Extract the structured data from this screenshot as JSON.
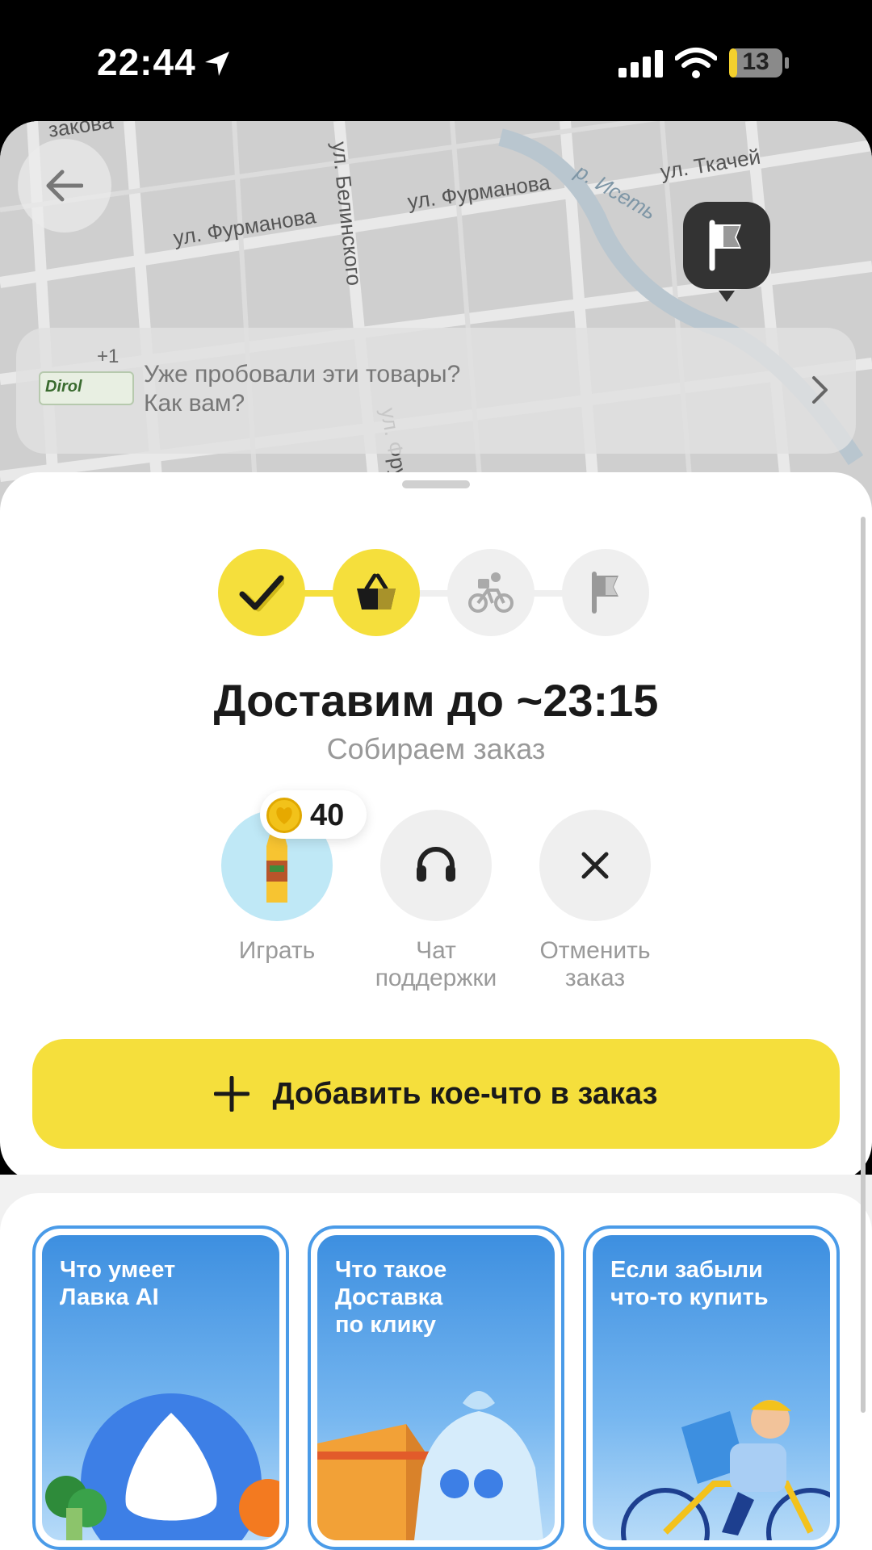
{
  "status_bar": {
    "time": "22:44",
    "battery": "13"
  },
  "map": {
    "streets": [
      "ул. Фурманова",
      "ул. Фурманова",
      "ул. Белинского",
      "ул. Ткачей",
      "р. Исеть",
      "ул. Фрунзе",
      "ул. Фрунзе",
      "ул. Бели",
      "закова"
    ]
  },
  "review_prompt": {
    "plus_count": "+1",
    "thumb_text": "Dirol",
    "line1": "Уже пробовали эти товары?",
    "line2": "Как вам?"
  },
  "order": {
    "eta_title": "Доставим до ~23:15",
    "status": "Собираем заказ",
    "steps": [
      {
        "name": "confirmed",
        "icon": "check-icon",
        "state": "done"
      },
      {
        "name": "assembling",
        "icon": "basket-icon",
        "state": "done"
      },
      {
        "name": "courier",
        "icon": "cyclist-icon",
        "state": "pending"
      },
      {
        "name": "delivered",
        "icon": "flag-icon",
        "state": "pending"
      }
    ]
  },
  "actions": {
    "play_label": "Играть",
    "coins": "40",
    "support_line1": "Чат",
    "support_line2": "поддержки",
    "cancel_line1": "Отменить",
    "cancel_line2": "заказ"
  },
  "add_button": {
    "label": "Добавить кое-что в заказ"
  },
  "stories": [
    {
      "title_line1": "Что умеет",
      "title_line2": "Лавка AI",
      "title_line3": ""
    },
    {
      "title_line1": "Что такое",
      "title_line2": "Доставка",
      "title_line3": "по клику"
    },
    {
      "title_line1": "Если забыли",
      "title_line2": "что-то купить",
      "title_line3": ""
    }
  ],
  "colors": {
    "accent_yellow": "#f5df3c",
    "step_pending": "#efefef",
    "story_blue": "#4a9be8"
  }
}
